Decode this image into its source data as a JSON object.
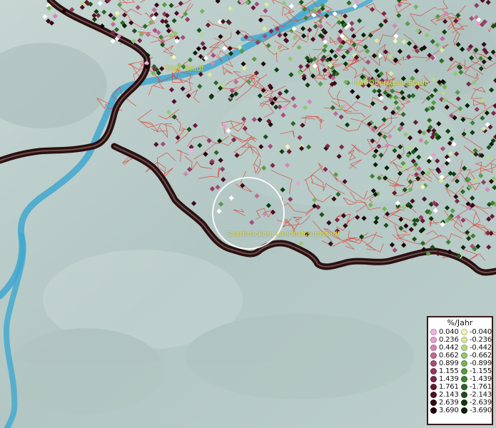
{
  "map": {
    "labels": {
      "trier": "Trier, Stadt",
      "idar": "Idar-Oberstein, Stadt",
      "saarbruecken": "Saarbrücken, Landeshauptstadt"
    },
    "colors": {
      "land": "#b9cbc8",
      "river": "#3fa7d0",
      "border": "#2a1010",
      "district_lines": "#e03b2f",
      "label": "#e8e23a",
      "selection_circle": "#ffffff"
    }
  },
  "legend": {
    "title": "%/Jahr",
    "positive": [
      {
        "value": "0.040",
        "color": "#f2b3e8"
      },
      {
        "value": "0.236",
        "color": "#e6a0cf"
      },
      {
        "value": "0.442",
        "color": "#d487b5"
      },
      {
        "value": "0.662",
        "color": "#c06a97"
      },
      {
        "value": "0.899",
        "color": "#a84d79"
      },
      {
        "value": "1.155",
        "color": "#93395f"
      },
      {
        "value": "1.439",
        "color": "#7d2848"
      },
      {
        "value": "1.761",
        "color": "#671a33"
      },
      {
        "value": "2.143",
        "color": "#4f0f22"
      },
      {
        "value": "2.639",
        "color": "#370715"
      },
      {
        "value": "3.690",
        "color": "#1c0208"
      }
    ],
    "negative": [
      {
        "value": "-0.040",
        "color": "#f2f5b0"
      },
      {
        "value": "-0.236",
        "color": "#d6eba2"
      },
      {
        "value": "-0.442",
        "color": "#b6d98b"
      },
      {
        "value": "-0.662",
        "color": "#96c675"
      },
      {
        "value": "-0.899",
        "color": "#78b260"
      },
      {
        "value": "-1.155",
        "color": "#5a9a47"
      },
      {
        "value": "-1.439",
        "color": "#3f8033"
      },
      {
        "value": "-1.761",
        "color": "#2a6824"
      },
      {
        "value": "-2.143",
        "color": "#1a5018"
      },
      {
        "value": "-2.639",
        "color": "#0e3a0e"
      },
      {
        "value": "-3.690",
        "color": "#052205"
      }
    ]
  }
}
